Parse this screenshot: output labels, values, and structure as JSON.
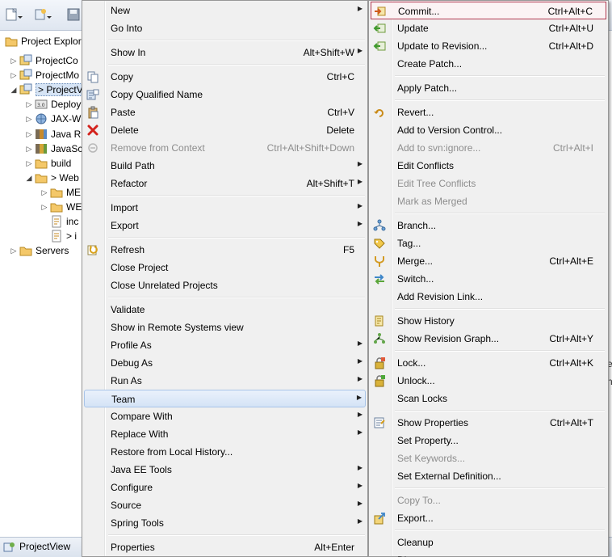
{
  "explorer": {
    "tab_label": "Project Explorer",
    "tree": [
      {
        "label": "ProjectCo",
        "indent": 0,
        "arrow": "▷",
        "icon": "project"
      },
      {
        "label": "ProjectMo",
        "indent": 0,
        "arrow": "▷",
        "icon": "project"
      },
      {
        "label": "> ProjectV",
        "indent": 0,
        "arrow": "◢",
        "icon": "project",
        "selected": true
      },
      {
        "label": "Deploy",
        "indent": 1,
        "arrow": "▷",
        "icon": "deploy"
      },
      {
        "label": "JAX-W",
        "indent": 1,
        "arrow": "▷",
        "icon": "jax"
      },
      {
        "label": "Java R",
        "indent": 1,
        "arrow": "▷",
        "icon": "java"
      },
      {
        "label": "JavaSc",
        "indent": 1,
        "arrow": "▷",
        "icon": "javascript"
      },
      {
        "label": "build",
        "indent": 1,
        "arrow": "▷",
        "icon": "folder"
      },
      {
        "label": "> Web",
        "indent": 1,
        "arrow": "◢",
        "icon": "folder"
      },
      {
        "label": "ME",
        "indent": 2,
        "arrow": "▷",
        "icon": "folder"
      },
      {
        "label": "WE",
        "indent": 2,
        "arrow": "▷",
        "icon": "folder"
      },
      {
        "label": "inc",
        "indent": 2,
        "arrow": "",
        "icon": "file"
      },
      {
        "label": "> i",
        "indent": 2,
        "arrow": "",
        "icon": "file"
      },
      {
        "label": "Servers",
        "indent": 0,
        "arrow": "▷",
        "icon": "folder"
      }
    ]
  },
  "status": {
    "text": "ProjectView"
  },
  "menu1": {
    "items": [
      {
        "label": "New",
        "submenu": true
      },
      {
        "label": "Go Into"
      },
      {
        "sep": true
      },
      {
        "label": "Show In",
        "shortcut": "Alt+Shift+W",
        "submenu": true
      },
      {
        "sep": true
      },
      {
        "label": "Copy",
        "shortcut": "Ctrl+C",
        "icon": "copy-icon"
      },
      {
        "label": "Copy Qualified Name",
        "icon": "copy-qualified-icon"
      },
      {
        "label": "Paste",
        "shortcut": "Ctrl+V",
        "icon": "paste-icon"
      },
      {
        "label": "Delete",
        "shortcut": "Delete",
        "icon": "delete-icon"
      },
      {
        "label": "Remove from Context",
        "shortcut": "Ctrl+Alt+Shift+Down",
        "disabled": true,
        "icon": "remove-context-icon"
      },
      {
        "label": "Build Path",
        "submenu": true
      },
      {
        "label": "Refactor",
        "shortcut": "Alt+Shift+T",
        "submenu": true
      },
      {
        "sep": true
      },
      {
        "label": "Import",
        "submenu": true
      },
      {
        "label": "Export",
        "submenu": true
      },
      {
        "sep": true
      },
      {
        "label": "Refresh",
        "shortcut": "F5",
        "icon": "refresh-icon"
      },
      {
        "label": "Close Project"
      },
      {
        "label": "Close Unrelated Projects"
      },
      {
        "sep": true
      },
      {
        "label": "Validate"
      },
      {
        "label": "Show in Remote Systems view"
      },
      {
        "label": "Profile As",
        "submenu": true
      },
      {
        "label": "Debug As",
        "submenu": true
      },
      {
        "label": "Run As",
        "submenu": true
      },
      {
        "label": "Team",
        "submenu": true,
        "highlighted": true
      },
      {
        "label": "Compare With",
        "submenu": true
      },
      {
        "label": "Replace With",
        "submenu": true
      },
      {
        "label": "Restore from Local History..."
      },
      {
        "label": "Java EE Tools",
        "submenu": true
      },
      {
        "label": "Configure",
        "submenu": true
      },
      {
        "label": "Source",
        "submenu": true
      },
      {
        "label": "Spring Tools",
        "submenu": true
      },
      {
        "sep": true
      },
      {
        "label": "Properties",
        "shortcut": "Alt+Enter"
      }
    ]
  },
  "menu2": {
    "items": [
      {
        "label": "Commit...",
        "shortcut": "Ctrl+Alt+C",
        "icon": "commit-icon",
        "boxed": true
      },
      {
        "label": "Update",
        "shortcut": "Ctrl+Alt+U",
        "icon": "update-icon"
      },
      {
        "label": "Update to Revision...",
        "shortcut": "Ctrl+Alt+D",
        "icon": "update-revision-icon"
      },
      {
        "label": "Create Patch..."
      },
      {
        "sep": true
      },
      {
        "label": "Apply Patch..."
      },
      {
        "sep": true
      },
      {
        "label": "Revert...",
        "icon": "revert-icon"
      },
      {
        "label": "Add to Version Control..."
      },
      {
        "label": "Add to svn:ignore...",
        "shortcut": "Ctrl+Alt+I",
        "disabled": true
      },
      {
        "label": "Edit Conflicts"
      },
      {
        "label": "Edit Tree Conflicts",
        "disabled": true
      },
      {
        "label": "Mark as Merged",
        "disabled": true
      },
      {
        "sep": true
      },
      {
        "label": "Branch...",
        "icon": "branch-icon"
      },
      {
        "label": "Tag...",
        "icon": "tag-icon"
      },
      {
        "label": "Merge...",
        "shortcut": "Ctrl+Alt+E",
        "icon": "merge-icon"
      },
      {
        "label": "Switch...",
        "icon": "switch-icon"
      },
      {
        "label": "Add Revision Link..."
      },
      {
        "sep": true
      },
      {
        "label": "Show History",
        "icon": "history-icon"
      },
      {
        "label": "Show Revision Graph...",
        "shortcut": "Ctrl+Alt+Y",
        "icon": "revision-graph-icon"
      },
      {
        "sep": true
      },
      {
        "label": "Lock...",
        "shortcut": "Ctrl+Alt+K",
        "icon": "lock-icon"
      },
      {
        "label": "Unlock...",
        "icon": "unlock-icon"
      },
      {
        "label": "Scan Locks"
      },
      {
        "sep": true
      },
      {
        "label": "Show Properties",
        "shortcut": "Ctrl+Alt+T",
        "icon": "properties-icon"
      },
      {
        "label": "Set Property..."
      },
      {
        "label": "Set Keywords...",
        "disabled": true
      },
      {
        "label": "Set External Definition..."
      },
      {
        "sep": true
      },
      {
        "label": "Copy To...",
        "disabled": true
      },
      {
        "label": "Export...",
        "icon": "export-icon"
      },
      {
        "sep": true
      },
      {
        "label": "Cleanup"
      },
      {
        "label": "Di..."
      }
    ]
  }
}
